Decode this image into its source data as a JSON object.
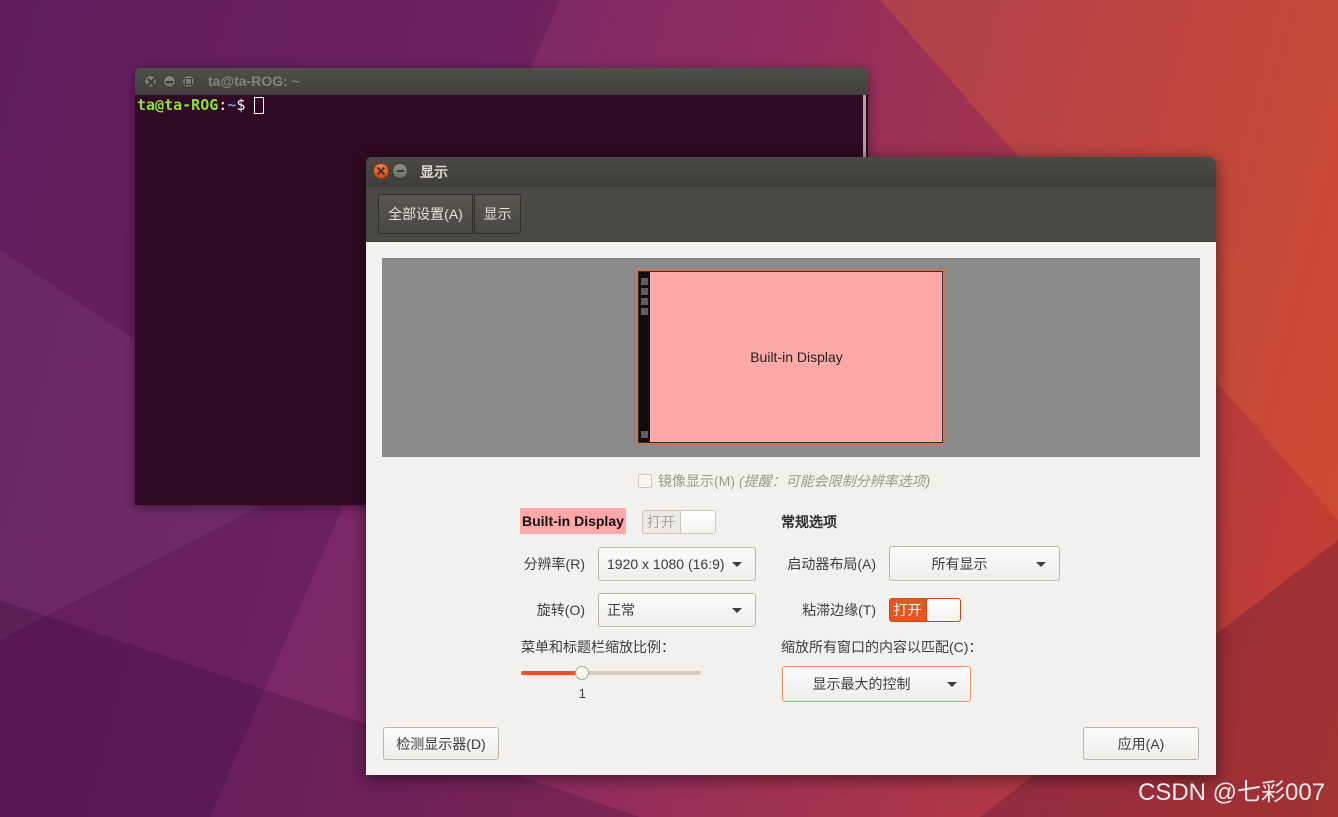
{
  "desktop": {
    "watermark": "CSDN @七彩007"
  },
  "terminal": {
    "title": "ta@ta-ROG: ~",
    "prompt_user_host": "ta@ta-ROG",
    "prompt_separator": ":",
    "prompt_path": "~",
    "prompt_symbol": "$"
  },
  "display_window": {
    "title": "显示",
    "toolbar": {
      "all_settings": "全部设置(A)",
      "current_panel": "显示"
    },
    "preview": {
      "monitor_label": "Built-in Display"
    },
    "mirror": {
      "label": "镜像显示(M)",
      "hint": "(提醒：可能会限制分辨率选项)",
      "checked": false,
      "enabled": false
    },
    "monitor": {
      "name": "Built-in Display",
      "power_switch": {
        "label": "打开",
        "on": true,
        "enabled": false
      },
      "resolution_label": "分辨率(R)",
      "resolution_value": "1920 x 1080 (16:9)",
      "rotation_label": "旋转(O)",
      "rotation_value": "正常",
      "scale_label": "菜单和标题栏缩放比例：",
      "scale_value": "1",
      "scale_slider_level": 0.34
    },
    "general": {
      "heading": "常规选项",
      "launcher_label": "启动器布局(A)",
      "launcher_value": "所有显示",
      "sticky_label": "粘滞边缘(T)",
      "sticky_switch": {
        "label": "打开",
        "on": true,
        "enabled": true
      },
      "scale_all_label": "缩放所有窗口的内容以匹配(C)：",
      "scale_all_value": "显示最大的控制"
    },
    "buttons": {
      "detect": "检测显示器(D)",
      "apply": "应用(A)"
    }
  },
  "colors": {
    "accent": "#e95420",
    "monitor_fill": "#ffa8a8",
    "terminal_bg": "#300a24",
    "prompt_user": "#8ae234",
    "prompt_path": "#729fcf",
    "preview_bg": "#8a8a8a",
    "dialog_bg": "#f2f1f0",
    "titlebar": "#3f3e3a"
  }
}
